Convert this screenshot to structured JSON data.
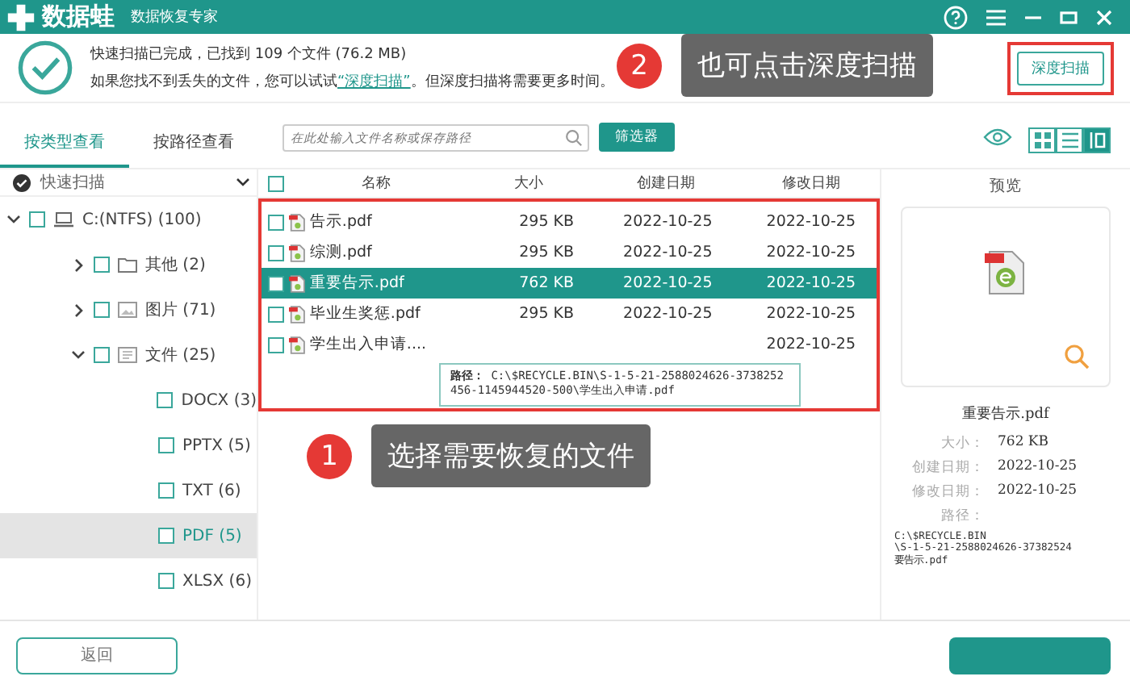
{
  "title_bar": {
    "app_name": "数据蛙",
    "subtitle": "数据恢复专家"
  },
  "scan_summary": {
    "line1": "快速扫描已完成，已找到 109 个文件 (76.2 MB)",
    "line2_before": "如果您找不到丢失的文件，您可以试试",
    "link": "“深度扫描”",
    "line2_after": "。但深度扫描将需要更多时间。"
  },
  "deep_scan_button": "深度扫描",
  "callouts": [
    {
      "number": "2",
      "text": "也可点击深度扫描"
    },
    {
      "number": "1",
      "text": "选择需要恢复的文件"
    }
  ],
  "view_tabs": [
    {
      "label": "按类型查看",
      "selected": true
    },
    {
      "label": "按路径查看",
      "selected": false
    }
  ],
  "search": {
    "placeholder": "在此处输入文件名称或保存路径"
  },
  "filter_button": "筛选器",
  "view_modes": [
    {
      "kind": "grid",
      "selected": false
    },
    {
      "kind": "list",
      "selected": false
    },
    {
      "kind": "detail",
      "selected": true
    }
  ],
  "sidebar": {
    "scan_mode": "快速扫描",
    "tree": [
      {
        "label": "C:(NTFS) (100)",
        "kind": "drive",
        "expanded": true,
        "checked": false,
        "selected": false,
        "children": [
          {
            "label": "其他 (2)",
            "kind": "folder",
            "expanded": false,
            "checked": false,
            "selected": false
          },
          {
            "label": "图片 (71)",
            "kind": "image",
            "expanded": false,
            "checked": false,
            "selected": false
          },
          {
            "label": "文件 (25)",
            "kind": "doc",
            "expanded": true,
            "checked": false,
            "selected": false,
            "children": [
              {
                "label": "DOCX (3)",
                "checked": false,
                "selected": false
              },
              {
                "label": "PPTX (5)",
                "checked": false,
                "selected": false
              },
              {
                "label": "TXT (6)",
                "checked": false,
                "selected": false
              },
              {
                "label": "PDF (5)",
                "checked": false,
                "selected": true
              },
              {
                "label": "XLSX (6)",
                "checked": false,
                "selected": false
              }
            ]
          }
        ]
      }
    ]
  },
  "table": {
    "all_checked": false,
    "columns": [
      "名称",
      "大小",
      "创建日期",
      "修改日期"
    ],
    "rows": [
      {
        "name": "告示.pdf",
        "size": "295 KB",
        "created": "2022-10-25",
        "modified": "2022-10-25",
        "checked": false,
        "selected": false
      },
      {
        "name": "综测.pdf",
        "size": "295 KB",
        "created": "2022-10-25",
        "modified": "2022-10-25",
        "checked": false,
        "selected": false
      },
      {
        "name": "重要告示.pdf",
        "size": "762 KB",
        "created": "2022-10-25",
        "modified": "2022-10-25",
        "checked": false,
        "selected": true
      },
      {
        "name": "毕业生奖惩.pdf",
        "size": "295 KB",
        "created": "2022-10-25",
        "modified": "2022-10-25",
        "checked": false,
        "selected": false
      },
      {
        "name": "学生出入申请....",
        "modified": "2022-10-25",
        "checked": false,
        "selected": false
      }
    ]
  },
  "tooltip": {
    "label": "路径：",
    "path": "C:\\$RECYCLE.BIN\\S-1-5-21-2588024626-3738252456-1145944520-500\\学生出入申请.pdf"
  },
  "preview": {
    "title": "预览",
    "file_name": "重要告示.pdf",
    "fields": [
      {
        "label": "大小：",
        "value": "762 KB"
      },
      {
        "label": "创建日期：",
        "value": "2022-10-25"
      },
      {
        "label": "修改日期：",
        "value": "2022-10-25"
      }
    ],
    "path_label": "路径：",
    "path_lines": [
      "C:\\$RECYCLE.BIN",
      "\\S-1-5-21-2588024626-37382524",
      "要告示.pdf"
    ]
  },
  "back_button": "返回"
}
